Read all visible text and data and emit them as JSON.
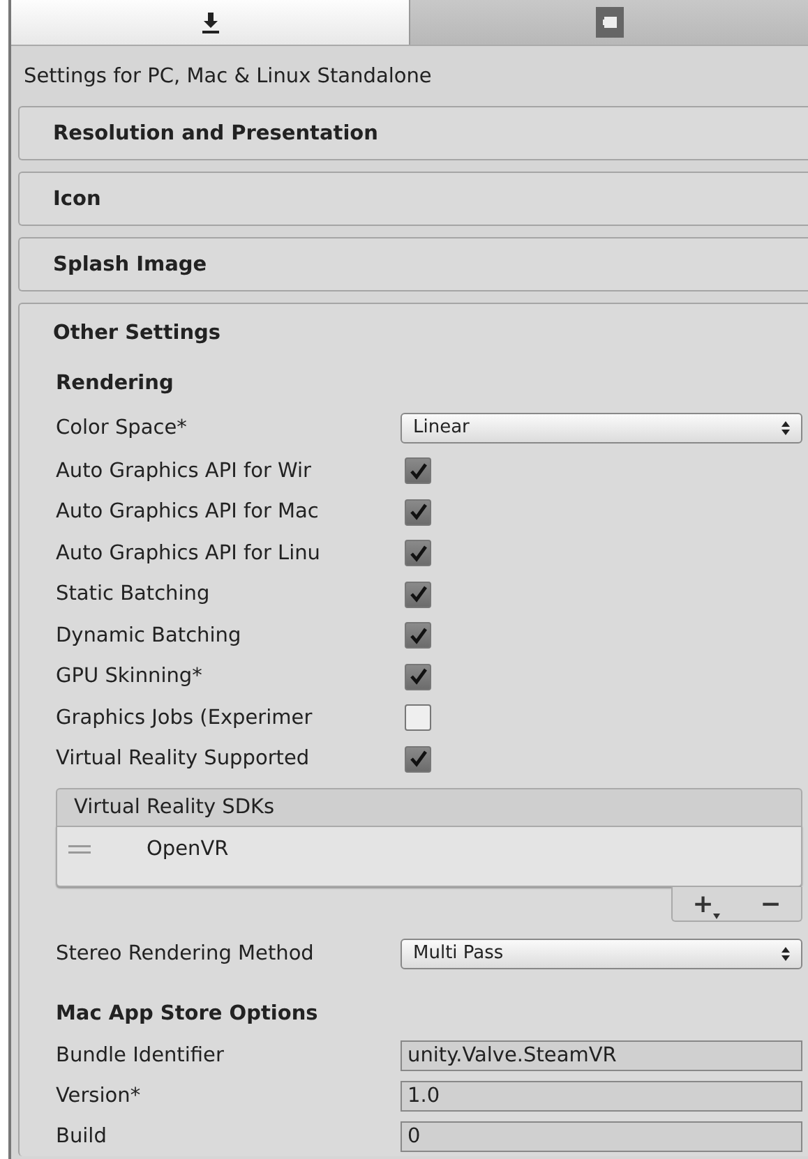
{
  "tabs": [
    {
      "kind": "download",
      "selected": true
    },
    {
      "kind": "window",
      "selected": false
    }
  ],
  "header": "Settings for PC, Mac & Linux Standalone",
  "sections": [
    {
      "title": "Resolution and Presentation",
      "expanded": false
    },
    {
      "title": "Icon",
      "expanded": false
    },
    {
      "title": "Splash Image",
      "expanded": false
    },
    {
      "title": "Other Settings",
      "expanded": true,
      "rows": [
        {
          "kind": "heading",
          "label": "Rendering"
        },
        {
          "kind": "dropdown",
          "label": "Color Space*",
          "value": "Linear"
        },
        {
          "kind": "checkbox",
          "label": "Auto Graphics API for Wir",
          "checked": true
        },
        {
          "kind": "checkbox",
          "label": "Auto Graphics API for Mac",
          "checked": true
        },
        {
          "kind": "checkbox",
          "label": "Auto Graphics API for Linu",
          "checked": true
        },
        {
          "kind": "checkbox",
          "label": "Static Batching",
          "checked": true
        },
        {
          "kind": "checkbox",
          "label": "Dynamic Batching",
          "checked": true
        },
        {
          "kind": "checkbox",
          "label": "GPU Skinning*",
          "checked": true
        },
        {
          "kind": "checkbox",
          "label": "Graphics Jobs (Experimer",
          "checked": false
        },
        {
          "kind": "checkbox",
          "label": "Virtual Reality Supported",
          "checked": true
        },
        {
          "kind": "list",
          "title": "Virtual Reality SDKs",
          "items": [
            "OpenVR"
          ],
          "add": "+",
          "remove": "−"
        },
        {
          "kind": "dropdown",
          "label": "Stereo Rendering Method",
          "value": "Multi Pass"
        },
        {
          "kind": "heading",
          "label": "Mac App Store Options"
        },
        {
          "kind": "field",
          "label": "Bundle Identifier",
          "value": "unity.Valve.SteamVR"
        },
        {
          "kind": "field",
          "label": "Version*",
          "value": "1.0"
        },
        {
          "kind": "field",
          "label": "Build",
          "value": "0"
        }
      ]
    }
  ]
}
